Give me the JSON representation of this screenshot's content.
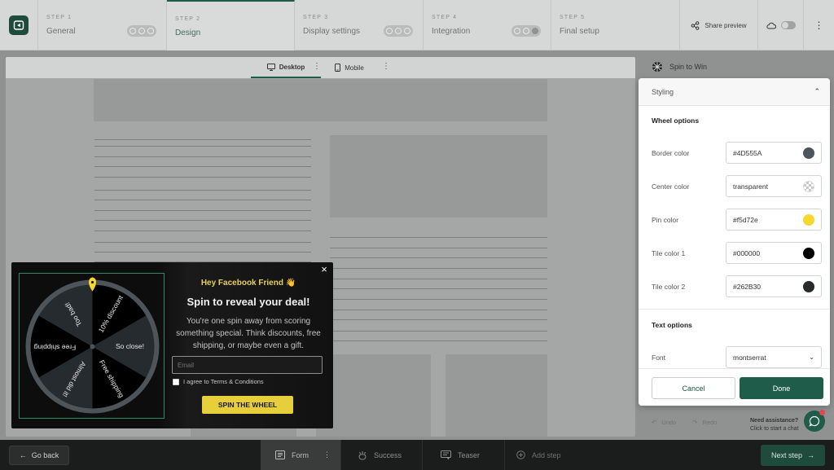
{
  "steps": [
    {
      "num": "STEP 1",
      "name": "General"
    },
    {
      "num": "STEP 2",
      "name": "Design"
    },
    {
      "num": "STEP 3",
      "name": "Display settings"
    },
    {
      "num": "STEP 4",
      "name": "Integration"
    },
    {
      "num": "STEP 5",
      "name": "Final setup"
    }
  ],
  "header": {
    "share_label": "Share preview"
  },
  "device_tabs": {
    "desktop": "Desktop",
    "mobile": "Mobile"
  },
  "popup": {
    "close": "×",
    "hey": "Hey Facebook Friend 👋",
    "title": "Spin to reveal your deal!",
    "body": "You're one spin away from scoring something special. Think discounts, free shipping, or maybe even a gift.",
    "email_placeholder": "Email",
    "agree": "I agree to Terms & Conditions",
    "spin_button": "SPIN THE WHEEL"
  },
  "wheel": {
    "slices": [
      "10% discount",
      "So close!",
      "Free shipping",
      "Almost did it!",
      "Free shipping",
      "Too bad!"
    ],
    "colors": {
      "border": "#4D555A",
      "pin": "#f5d72e",
      "tile1": "#000000",
      "tile2": "#262B30"
    }
  },
  "panel": {
    "title": "Spin to Win",
    "undo": "Undo",
    "redo": "Redo",
    "assist_title": "Need assistance?",
    "assist_sub": "Click to start a chat"
  },
  "modal": {
    "section": "Styling",
    "wheel_options": "Wheel options",
    "fields": [
      {
        "label": "Border color",
        "value": "#4D555A",
        "swatch": "#4D555A"
      },
      {
        "label": "Center color",
        "value": "transparent",
        "swatch": "transparent"
      },
      {
        "label": "Pin color",
        "value": "#f5d72e",
        "swatch": "#f5d72e"
      },
      {
        "label": "Tile color 1",
        "value": "#000000",
        "swatch": "#000000"
      },
      {
        "label": "Tile color 2",
        "value": "#262B30",
        "swatch": "#262B30"
      }
    ],
    "text_options": "Text options",
    "font_label": "Font",
    "font_value": "montserrat",
    "cancel": "Cancel",
    "done": "Done"
  },
  "bottom": {
    "go_back": "Go back",
    "tabs": [
      "Form",
      "Success",
      "Teaser",
      "Add step"
    ],
    "next": "Next step"
  }
}
